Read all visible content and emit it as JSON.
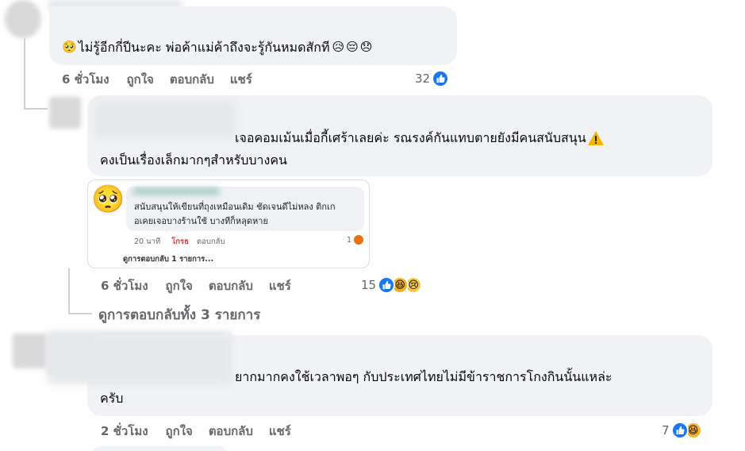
{
  "comment1": {
    "text": "ไม่รู้อีกกี่ปีนะคะ พ่อค้าแม่ค้าถึงจะรู้กันหมดสักที",
    "actions": {
      "time": "6 ชั่วโมง",
      "like": "ถูกใจ",
      "reply": "ตอบกลับ",
      "share": "แชร์"
    },
    "reaction_count": "32"
  },
  "reply1": {
    "line1": "เจอคอมเม้นเมื่อกี้เศร้าเลยค่ะ รณรงค์กันแทบตายยังมีคนสนับสนุน",
    "line2": "คงเป็นเรื่องเล็กมากๆสำหรับบางคน",
    "screenshot": {
      "line1": "สนับสนุนให้เขียนที่ถุงเหมือนเดิม ชัดเจนดีไม่หลง ติกเก",
      "line2": "อเคยเจอบางร้านใช้ บางทีก็หลุดหาย",
      "time": "20 นาที",
      "like": "โกรธ",
      "reply": "ตอบกลับ",
      "count": "1",
      "view_replies": "ดูการตอบกลับ 1 รายการ..."
    },
    "actions": {
      "time": "6 ชั่วโมง",
      "like": "ถูกใจ",
      "reply": "ตอบกลับ",
      "share": "แชร์"
    },
    "reaction_count": "15"
  },
  "view_all_replies": "ดูการตอบกลับทั้ง 3 รายการ",
  "comment2": {
    "line1": "ยากมากคงใช้เวลาพอๆ กับประเทศไทยไม่มีข้าราชการโกงกินนั้นแหล่ะ",
    "line2": "ครับ",
    "actions": {
      "time": "2 ชั่วโมง",
      "like": "ถูกใจ",
      "reply": "ตอบกลับ",
      "share": "แชร์"
    },
    "reaction_count": "7"
  },
  "colors": {
    "like_blue": "#1877f2",
    "bubble_gray": "#f0f2f5",
    "meta_gray": "#65676b",
    "warning": "#f5b400"
  }
}
